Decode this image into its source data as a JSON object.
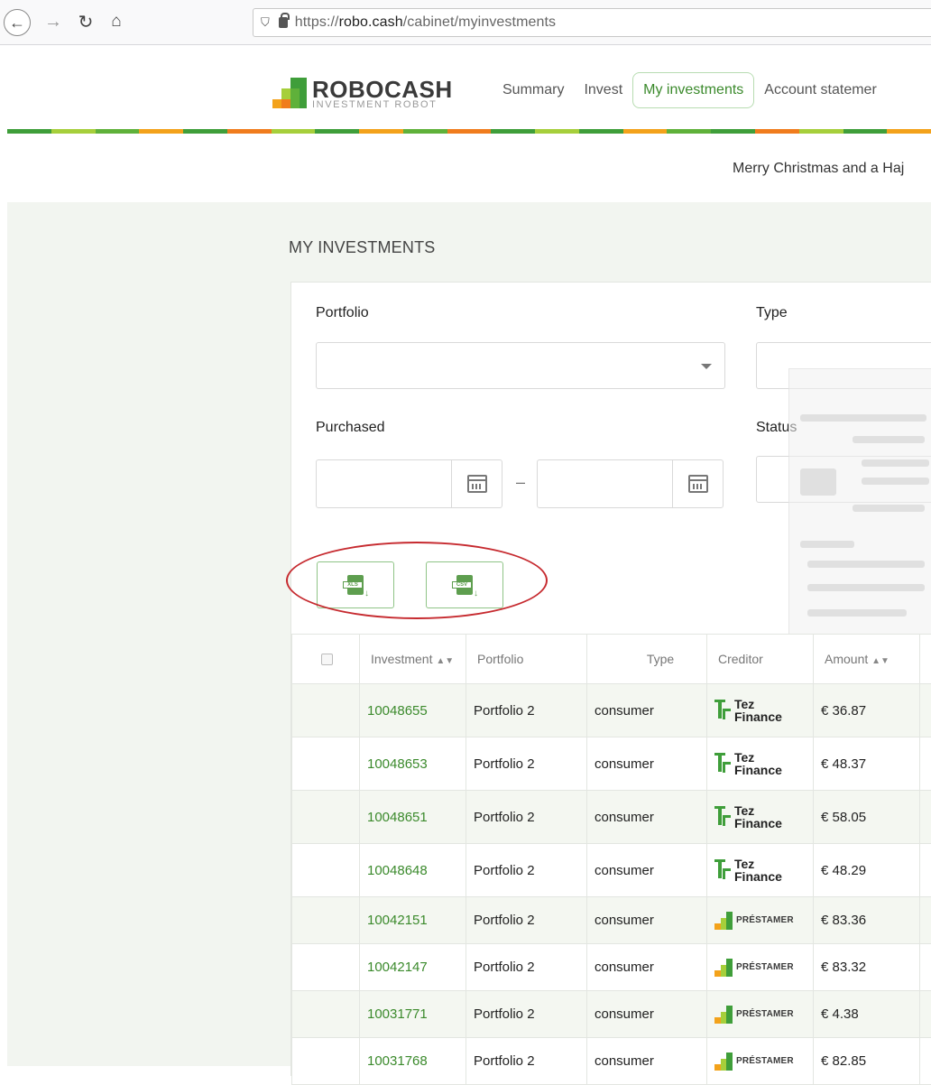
{
  "browser": {
    "url_prefix": "https://",
    "url_domain": "robo.cash",
    "url_path": "/cabinet/myinvestments"
  },
  "brand": {
    "name": "ROBOCASH",
    "tagline": "INVESTMENT ROBOT"
  },
  "nav": {
    "items": [
      {
        "label": "Summary"
      },
      {
        "label": "Invest"
      },
      {
        "label": "My investments"
      },
      {
        "label": "Account statemer"
      }
    ],
    "active": "My investments"
  },
  "promo": "Merry Christmas and a Haj",
  "page_title": "MY INVESTMENTS",
  "filters": {
    "portfolio_label": "Portfolio",
    "type_label": "Type",
    "purchased_label": "Purchased",
    "status_label": "Status",
    "date_separator": "–"
  },
  "exports": [
    {
      "tag": "XLS"
    },
    {
      "tag": "CSV"
    }
  ],
  "table": {
    "headers": {
      "investment": "Investment",
      "portfolio": "Portfolio",
      "type": "Type",
      "creditor": "Creditor",
      "amount": "Amount"
    },
    "rows": [
      {
        "id": "10048655",
        "portfolio": "Portfolio 2",
        "type": "consumer",
        "creditor": "Tez Finance",
        "amount": "€ 36.87"
      },
      {
        "id": "10048653",
        "portfolio": "Portfolio 2",
        "type": "consumer",
        "creditor": "Tez Finance",
        "amount": "€ 48.37"
      },
      {
        "id": "10048651",
        "portfolio": "Portfolio 2",
        "type": "consumer",
        "creditor": "Tez Finance",
        "amount": "€ 58.05"
      },
      {
        "id": "10048648",
        "portfolio": "Portfolio 2",
        "type": "consumer",
        "creditor": "Tez Finance",
        "amount": "€ 48.29"
      },
      {
        "id": "10042151",
        "portfolio": "Portfolio 2",
        "type": "consumer",
        "creditor": "PRÉSTAMER",
        "amount": "€ 83.36"
      },
      {
        "id": "10042147",
        "portfolio": "Portfolio 2",
        "type": "consumer",
        "creditor": "PRÉSTAMER",
        "amount": "€ 83.32"
      },
      {
        "id": "10031771",
        "portfolio": "Portfolio 2",
        "type": "consumer",
        "creditor": "PRÉSTAMER",
        "amount": "€ 4.38"
      },
      {
        "id": "10031768",
        "portfolio": "Portfolio 2",
        "type": "consumer",
        "creditor": "PRÉSTAMER",
        "amount": "€ 82.85"
      }
    ]
  },
  "icons": {
    "back": "back-arrow-icon",
    "forward": "forward-arrow-icon",
    "reload": "reload-icon",
    "home": "home-icon",
    "shield": "shield-icon",
    "lock": "lock-icon",
    "calendar": "calendar-icon",
    "export": "document-download-icon"
  },
  "colors": {
    "accent_green": "#3b8a2c",
    "annotation_red": "#c62a2f",
    "content_bg": "#f2f5f0"
  }
}
